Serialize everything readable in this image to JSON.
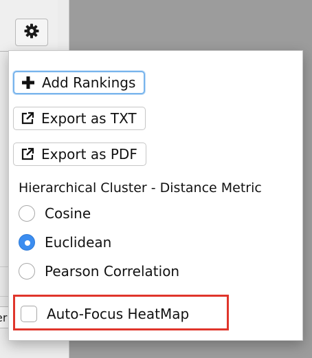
{
  "background": {
    "strip_text": "er"
  },
  "toolbar": {
    "settings_icon": "gear-icon"
  },
  "menu": {
    "buttons": [
      {
        "label": "Add Rankings",
        "icon": "plus-icon",
        "focused": true
      },
      {
        "label": "Export as TXT",
        "icon": "external-link-icon",
        "focused": false
      },
      {
        "label": "Export as PDF",
        "icon": "external-link-icon",
        "focused": false
      }
    ],
    "cluster_section_label": "Hierarchical Cluster - Distance Metric",
    "distance_metric_options": [
      {
        "label": "Cosine",
        "selected": false
      },
      {
        "label": "Euclidean",
        "selected": true
      },
      {
        "label": "Pearson Correlation",
        "selected": false
      }
    ],
    "auto_focus": {
      "label": "Auto-Focus HeatMap",
      "checked": false
    }
  },
  "colors": {
    "accent": "#3b8df0",
    "focus_ring": "#78b4ec",
    "highlight": "#e0352b"
  }
}
